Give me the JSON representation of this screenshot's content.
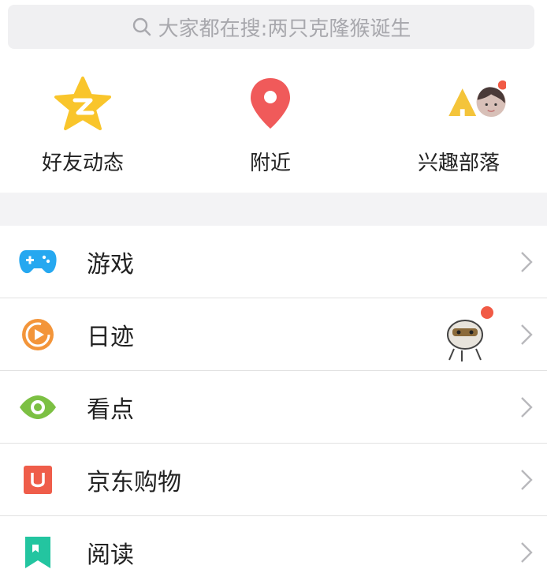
{
  "search": {
    "placeholder": "大家都在搜:两只克隆猴诞生"
  },
  "quick_actions": [
    {
      "label": "好友动态",
      "icon": "qzone-star-icon"
    },
    {
      "label": "附近",
      "icon": "location-pin-icon"
    },
    {
      "label": "兴趣部落",
      "icon": "tribe-tent-icon"
    }
  ],
  "list": [
    {
      "label": "游戏",
      "icon": "gamepad-icon",
      "color": "#26a8f0"
    },
    {
      "label": "日迹",
      "icon": "daily-trace-icon",
      "color": "#f3953a"
    },
    {
      "label": "看点",
      "icon": "eye-icon",
      "color": "#7cc043"
    },
    {
      "label": "京东购物",
      "icon": "jd-shopping-icon",
      "color": "#ef5d4a"
    },
    {
      "label": "阅读",
      "icon": "bookmark-icon",
      "color": "#23c5a0"
    }
  ],
  "colors": {
    "badge": "#f15a45",
    "star": "#f9c52b",
    "pin": "#f05a5a",
    "tent": "#f4c43a"
  }
}
